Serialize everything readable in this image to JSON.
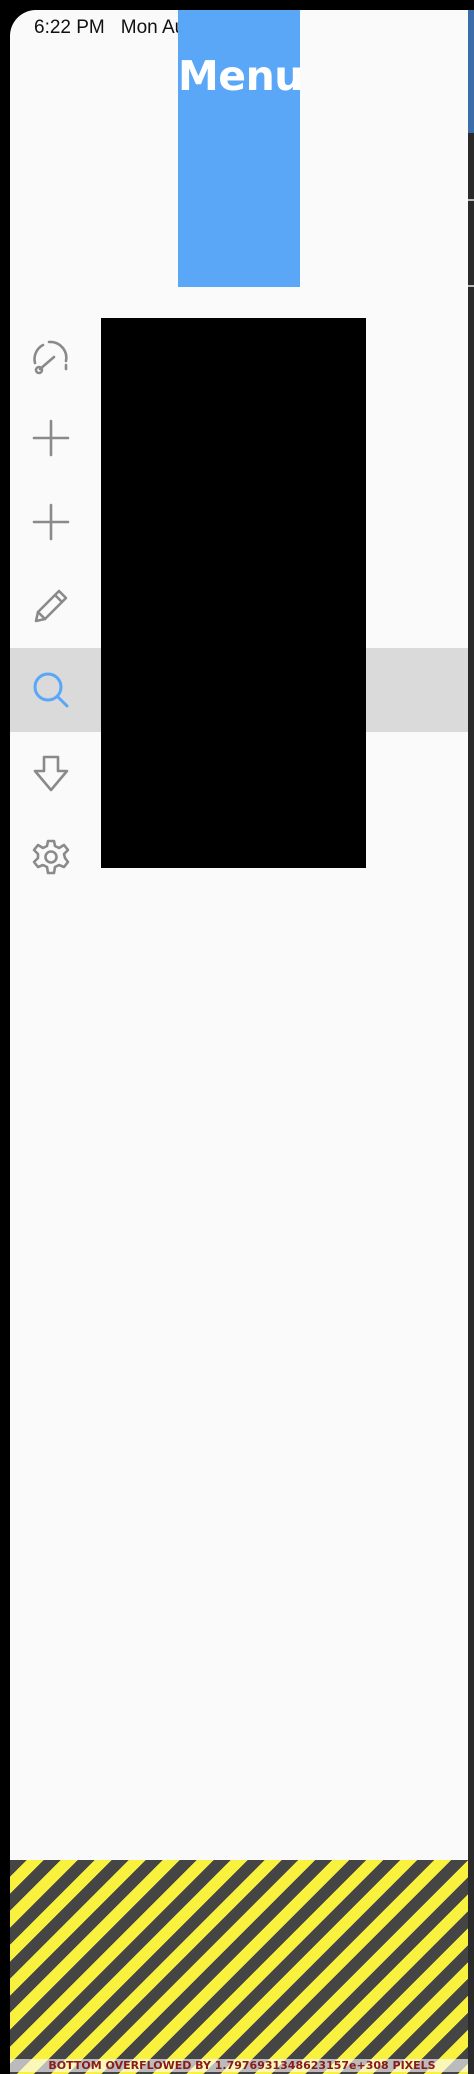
{
  "status_bar": {
    "time": "6:22 PM",
    "date": "Mon Aug 1"
  },
  "menu": {
    "title": "Menu"
  },
  "nav": [
    {
      "icon": "speedometer-icon",
      "selected": false
    },
    {
      "icon": "plus-icon",
      "selected": false
    },
    {
      "icon": "plus-icon",
      "selected": false
    },
    {
      "icon": "pencil-icon",
      "selected": false
    },
    {
      "icon": "search-icon",
      "selected": true
    },
    {
      "icon": "download-arrow-icon",
      "selected": false
    },
    {
      "icon": "settings-gear-icon",
      "selected": false
    }
  ],
  "colors": {
    "accent": "#5aa6f7",
    "icon_default": "#8a8a8a",
    "selected_row": "#dadada",
    "overflow_stripe_dark": "#454545",
    "overflow_stripe_yellow": "#f8f13d",
    "overflow_text": "#8b1a1a"
  },
  "debug": {
    "overflow_message": "BOTTOM OVERFLOWED BY 1.7976931348623157e+308 PIXELS"
  }
}
